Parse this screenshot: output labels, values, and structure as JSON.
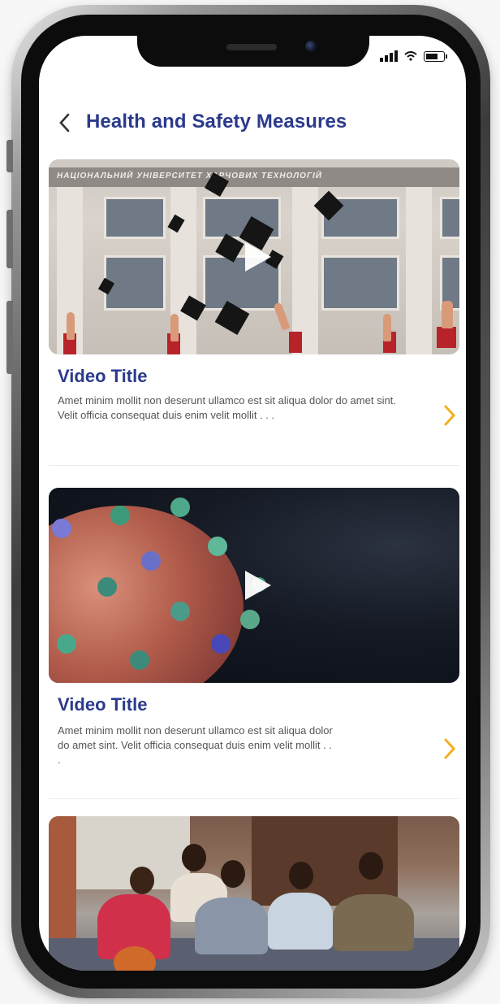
{
  "header": {
    "title": "Health and Safety Measures"
  },
  "videos": [
    {
      "title": "Video Title",
      "description": "Amet minim mollit non deserunt ullamco est sit aliqua dolor do amet sint. Velit officia consequat duis enim velit mollit . . .",
      "thumbnail_banner": "НАЦІОНАЛЬНИЙ УНІВЕРСИТЕТ ХАРЧОВИХ ТЕХНОЛОГІЙ"
    },
    {
      "title": "Video Title",
      "description": "Amet minim mollit non deserunt ullamco est sit aliqua dolor do amet sint. Velit officia consequat duis enim velit mollit . . ."
    },
    {
      "title": "",
      "description": ""
    }
  ],
  "colors": {
    "accent": "#2b3a8c",
    "chevron": "#f2b01e",
    "text_muted": "#555555"
  },
  "icons": {
    "back": "chevron-left-icon",
    "play": "play-icon",
    "next": "chevron-right-icon",
    "signal": "signal-icon",
    "wifi": "wifi-icon",
    "battery": "battery-icon"
  }
}
